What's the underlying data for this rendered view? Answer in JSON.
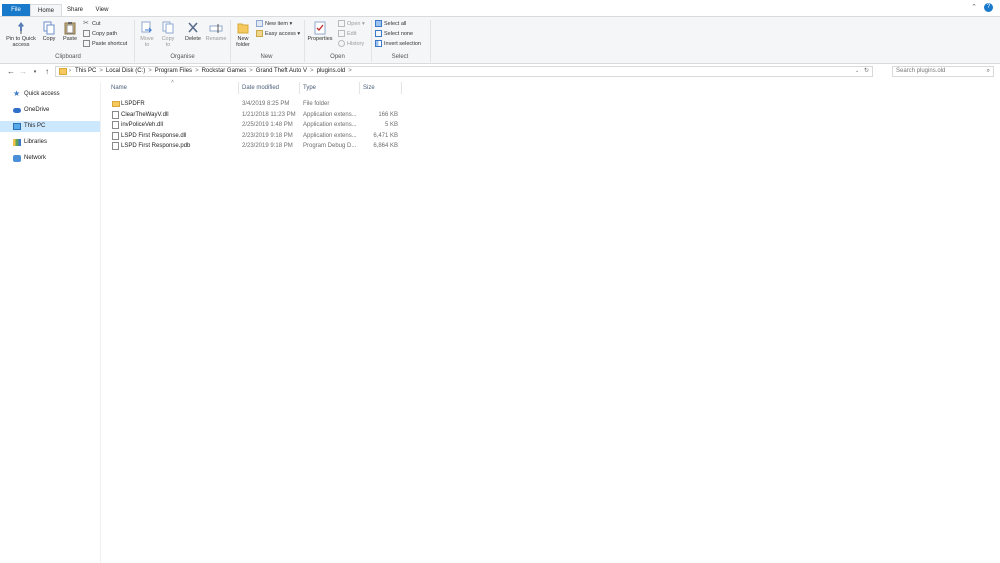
{
  "tabs": {
    "file": "File",
    "home": "Home",
    "share": "Share",
    "view": "View"
  },
  "ribbon": {
    "clipboard": {
      "pin": "Pin to Quick access",
      "copy": "Copy",
      "paste": "Paste",
      "cut": "Cut",
      "copy_path": "Copy path",
      "paste_shortcut": "Paste shortcut",
      "label": "Clipboard"
    },
    "organise": {
      "move_to": "Move to",
      "copy_to": "Copy to",
      "delete": "Delete",
      "rename": "Rename",
      "label": "Organise"
    },
    "new": {
      "new_folder": "New folder",
      "new_item": "New item",
      "easy_access": "Easy access",
      "label": "New"
    },
    "open": {
      "properties": "Properties",
      "open": "Open",
      "edit": "Edit",
      "history": "History",
      "label": "Open"
    },
    "select": {
      "select_all": "Select all",
      "select_none": "Select none",
      "invert_selection": "Invert selection",
      "label": "Select"
    }
  },
  "address": {
    "crumbs": [
      "This PC",
      "Local Disk (C:)",
      "Program Files",
      "Rockstar Games",
      "Grand Theft Auto V",
      "plugins.old"
    ],
    "separator": ">"
  },
  "search": {
    "placeholder": "Search plugins.old"
  },
  "navpane": {
    "items": [
      {
        "label": "Quick access",
        "icon": "star-icon"
      },
      {
        "label": "OneDrive",
        "icon": "cloud-icon"
      },
      {
        "label": "This PC",
        "icon": "computer-icon"
      },
      {
        "label": "Libraries",
        "icon": "library-icon"
      },
      {
        "label": "Network",
        "icon": "network-icon"
      }
    ]
  },
  "columns": {
    "name": "Name",
    "date": "Date modified",
    "type": "Type",
    "size": "Size"
  },
  "files": [
    {
      "name": "LSPDFR",
      "date": "3/4/2019 8:25 PM",
      "type": "File folder",
      "size": "",
      "icon": "folder-icon"
    },
    {
      "name": "ClearTheWayV.dll",
      "date": "1/21/2018 11:23 PM",
      "type": "Application extens...",
      "size": "166 KB",
      "icon": "file-icon"
    },
    {
      "name": "invPoliceVeh.dll",
      "date": "2/25/2019 1:48 PM",
      "type": "Application extens...",
      "size": "5 KB",
      "icon": "file-icon"
    },
    {
      "name": "LSPD First Response.dll",
      "date": "2/23/2019 9:18 PM",
      "type": "Application extens...",
      "size": "6,471 KB",
      "icon": "file-icon"
    },
    {
      "name": "LSPD First Response.pdb",
      "date": "2/23/2019 9:18 PM",
      "type": "Program Debug D...",
      "size": "6,864 KB",
      "icon": "file-icon"
    }
  ],
  "colors": {
    "file_tab": "#1979ca",
    "selection": "#cce8ff",
    "folder": "#f5c95d"
  }
}
